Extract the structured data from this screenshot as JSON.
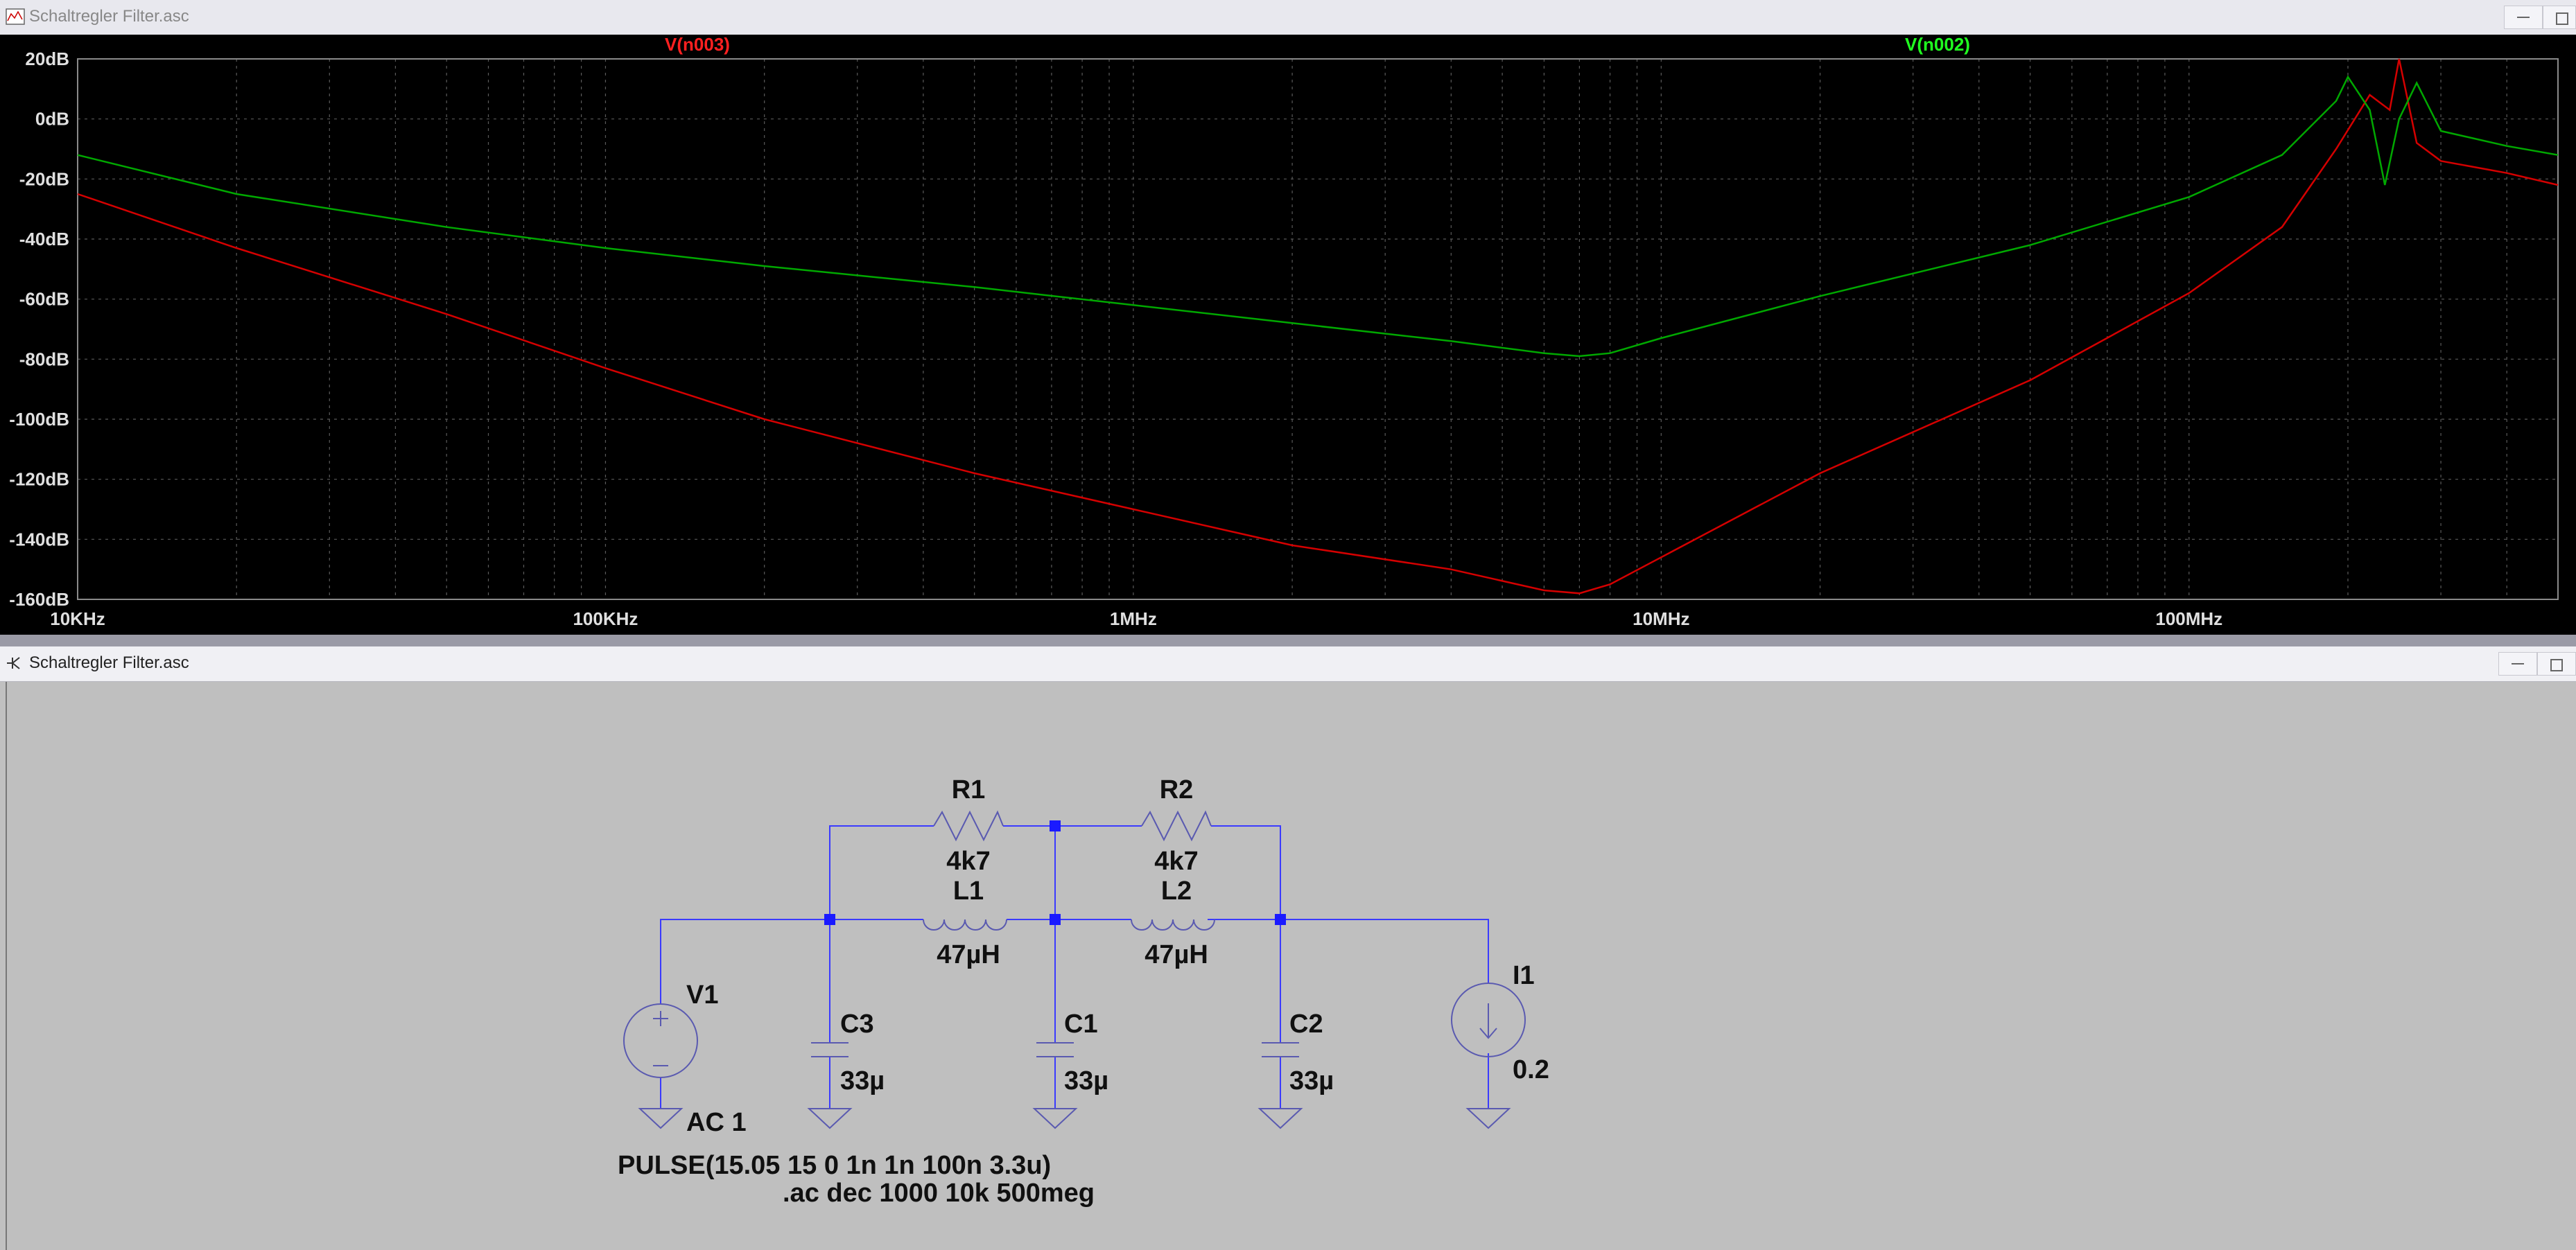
{
  "windows": {
    "plot_title": "Schaltregler Filter.asc",
    "schematic_title": "Schaltregler Filter.asc"
  },
  "colors": {
    "trace1": "#d40000",
    "trace2": "#00a800",
    "plot_bg": "#000000",
    "schematic_bg": "#bfbfbf",
    "wire": "#3a3aff"
  },
  "plot": {
    "trace1_label": "V(n003)",
    "trace2_label": "V(n002)",
    "y_ticks": [
      "20dB",
      "0dB",
      "-20dB",
      "-40dB",
      "-60dB",
      "-80dB",
      "-100dB",
      "-120dB",
      "-140dB",
      "-160dB"
    ],
    "x_ticks": [
      "10KHz",
      "100KHz",
      "1MHz",
      "10MHz",
      "100MHz"
    ]
  },
  "chart_data": {
    "type": "line",
    "x_scale": "log",
    "xlim": [
      10000,
      500000000
    ],
    "ylim": [
      -160,
      20
    ],
    "xlabel": "",
    "ylabel": "",
    "grid": true,
    "series": [
      {
        "name": "V(n003)",
        "color": "#d40000",
        "x": [
          10000,
          20000,
          50000,
          100000,
          200000,
          500000,
          1000000,
          2000000,
          4000000,
          6000000,
          7000000,
          8000000,
          10000000,
          20000000,
          50000000,
          100000000,
          150000000,
          190000000,
          220000000,
          240000000,
          250000000,
          270000000,
          300000000,
          400000000,
          500000000
        ],
        "y": [
          -25,
          -43,
          -65,
          -83,
          -100,
          -118,
          -130,
          -142,
          -150,
          -157,
          -158,
          -155,
          -146,
          -118,
          -87,
          -58,
          -36,
          -10,
          8,
          3,
          20,
          -8,
          -14,
          -18,
          -22
        ]
      },
      {
        "name": "V(n002)",
        "color": "#00a800",
        "x": [
          10000,
          20000,
          50000,
          100000,
          200000,
          500000,
          1000000,
          2000000,
          4000000,
          6000000,
          7000000,
          8000000,
          10000000,
          20000000,
          50000000,
          100000000,
          150000000,
          190000000,
          200000000,
          220000000,
          235000000,
          250000000,
          270000000,
          300000000,
          400000000,
          500000000
        ],
        "y": [
          -12,
          -25,
          -36,
          -43,
          -49,
          -56,
          -62,
          -68,
          -74,
          -78,
          -79,
          -78,
          -73,
          -59,
          -42,
          -26,
          -12,
          6,
          14,
          3,
          -22,
          0,
          12,
          -4,
          -9,
          -12
        ]
      }
    ]
  },
  "schematic": {
    "R1_name": "R1",
    "R1_value": "4k7",
    "R2_name": "R2",
    "R2_value": "4k7",
    "L1_name": "L1",
    "L1_value": "47µH",
    "L2_name": "L2",
    "L2_value": "47µH",
    "C1_name": "C1",
    "C1_value": "33µ",
    "C2_name": "C2",
    "C2_value": "33µ",
    "C3_name": "C3",
    "C3_value": "33µ",
    "V1_name": "V1",
    "V1_value": "AC 1",
    "I1_name": "I1",
    "I1_value": "0.2",
    "pulse_directive": "PULSE(15.05 15 0 1n 1n 100n 3.3u)",
    "ac_directive": ".ac dec 1000 10k 500meg"
  }
}
